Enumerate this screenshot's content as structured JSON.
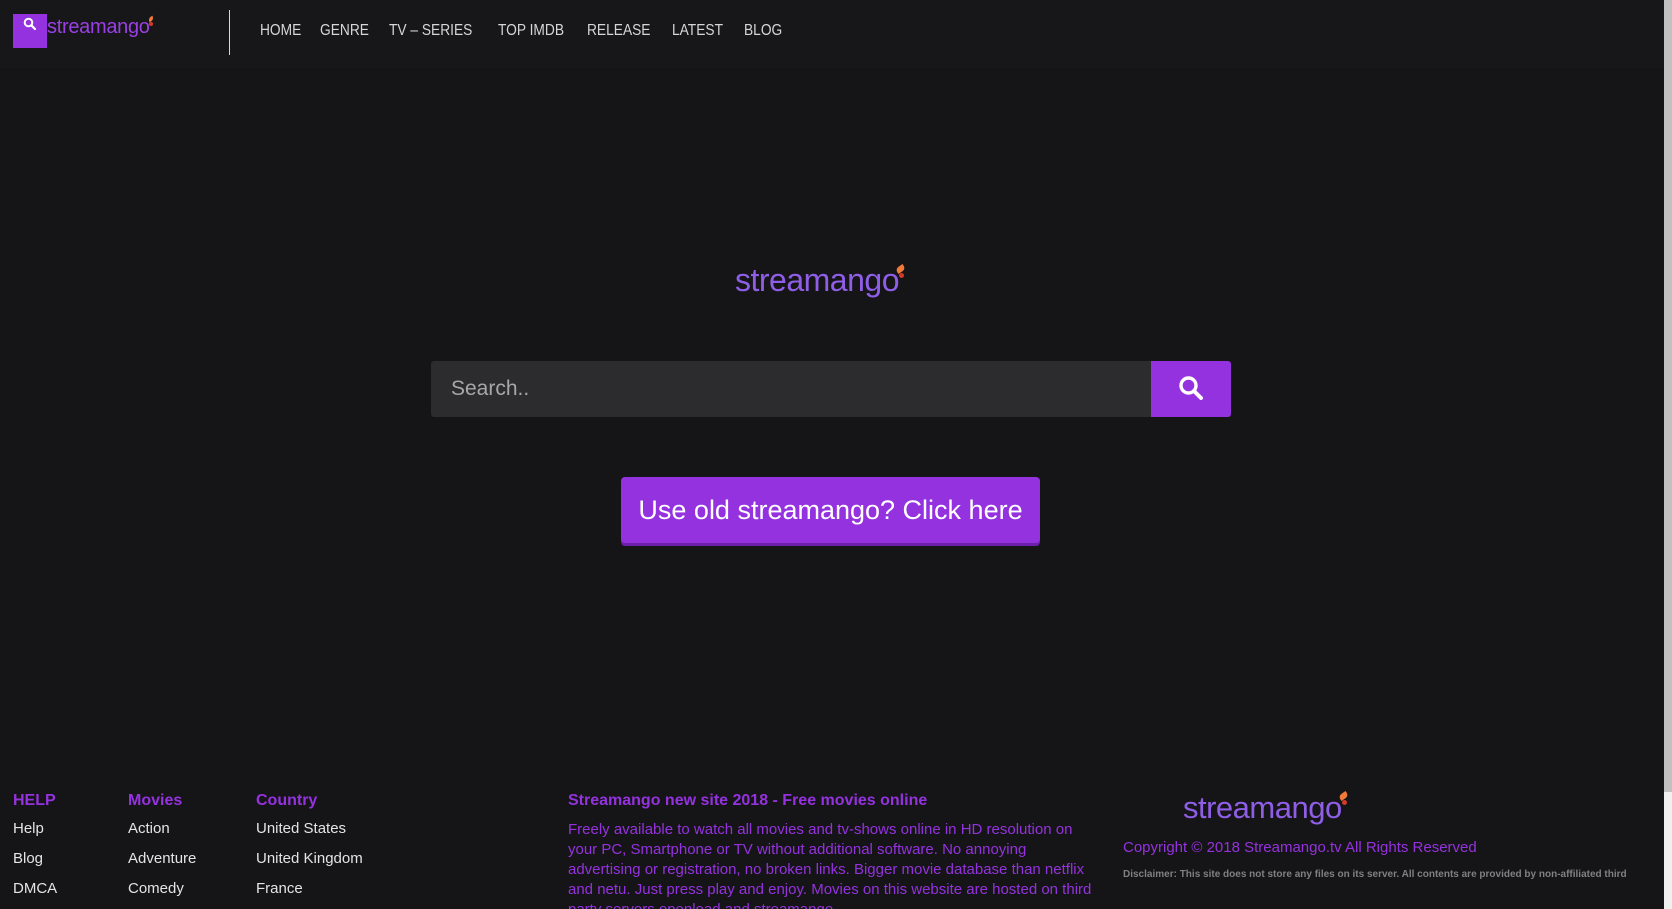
{
  "header": {
    "logo_text": "streamango",
    "nav": [
      "HOME",
      "GENRE",
      "TV – SERIES",
      "TOP IMDB",
      "RELEASE",
      "LATEST",
      "BLOG"
    ]
  },
  "hero": {
    "logo_text": "streamango",
    "search_placeholder": "Search..",
    "old_site_button": "Use old streamango? Click here"
  },
  "footer": {
    "help": {
      "heading": "HELP",
      "links": [
        "Help",
        "Blog",
        "DMCA"
      ]
    },
    "movies": {
      "heading": "Movies",
      "links": [
        "Action",
        "Adventure",
        "Comedy"
      ]
    },
    "country": {
      "heading": "Country",
      "links": [
        "United States",
        "United Kingdom",
        "France"
      ]
    },
    "about": {
      "title": "Streamango new site 2018 - Free movies online",
      "text": "Freely available to watch all movies and tv-shows online in HD resolution on your PC, Smartphone or TV without additional software. No annoying advertising or registration, no broken links. Bigger movie database than netflix and netu. Just press play and enjoy. Movies on this website are hosted on third party servers openload and streamango."
    },
    "logo_text": "streamango",
    "copyright": "Copyright © 2018 Streamango.tv All Rights Reserved",
    "disclaimer": "Disclaimer: This site does not store any files on its server. All contents are provided by non-affiliated third"
  },
  "colors": {
    "background": "#151416",
    "accent": "#9532e0",
    "logo_purple": "#8e5ee6",
    "nav_text": "#d6d6d6"
  },
  "icons": {
    "header_logo": "search-icon",
    "search_button": "search-icon"
  }
}
